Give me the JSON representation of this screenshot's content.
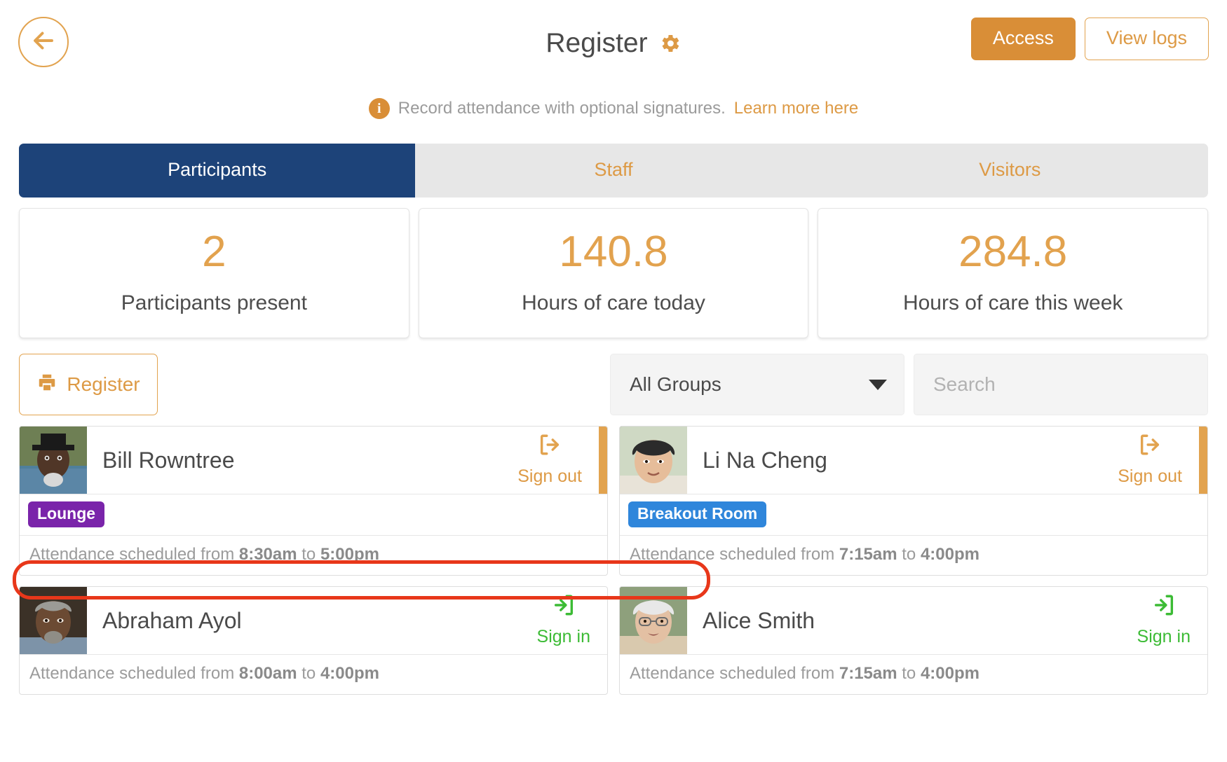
{
  "header": {
    "back_icon": "arrow-left-icon",
    "title": "Register",
    "title_icon": "gear-icon",
    "access_label": "Access",
    "view_logs_label": "View logs"
  },
  "info": {
    "icon": "info-icon",
    "badge_text": "i",
    "text": "Record attendance with optional signatures.",
    "link_text": "Learn more here"
  },
  "tabs": [
    {
      "label": "Participants",
      "active": true
    },
    {
      "label": "Staff",
      "active": false
    },
    {
      "label": "Visitors",
      "active": false
    }
  ],
  "stats": [
    {
      "value": "2",
      "label": "Participants present"
    },
    {
      "value": "140.8",
      "label": "Hours of care today"
    },
    {
      "value": "284.8",
      "label": "Hours of care this week"
    }
  ],
  "toolbar": {
    "register_label": "Register",
    "register_icon": "printer-icon",
    "group_filter_value": "All Groups",
    "group_filter_icon": "chevron-down-icon",
    "search_placeholder": "Search"
  },
  "people": [
    {
      "name": "Bill Rowntree",
      "action_label": "Sign out",
      "action_type": "sign-out",
      "action_icon": "sign-out-icon",
      "badge": {
        "text": "Lounge",
        "color": "#7a24aa"
      },
      "schedule_prefix": "Attendance scheduled from",
      "start_time": "8:30am",
      "schedule_mid": "to",
      "end_time": "5:00pm"
    },
    {
      "name": "Li Na Cheng",
      "action_label": "Sign out",
      "action_type": "sign-out",
      "action_icon": "sign-out-icon",
      "badge": {
        "text": "Breakout Room",
        "color": "#2f86db"
      },
      "schedule_prefix": "Attendance scheduled from",
      "start_time": "7:15am",
      "schedule_mid": "to",
      "end_time": "4:00pm"
    },
    {
      "name": "Abraham Ayol",
      "action_label": "Sign in",
      "action_type": "sign-in",
      "action_icon": "sign-in-icon",
      "badge": null,
      "schedule_prefix": "Attendance scheduled from",
      "start_time": "8:00am",
      "schedule_mid": "to",
      "end_time": "4:00pm"
    },
    {
      "name": "Alice Smith",
      "action_label": "Sign in",
      "action_type": "sign-in",
      "action_icon": "sign-in-icon",
      "badge": null,
      "schedule_prefix": "Attendance scheduled from",
      "start_time": "7:15am",
      "schedule_mid": "to",
      "end_time": "4:00pm"
    }
  ],
  "colors": {
    "accent_orange": "#d98e37",
    "tab_active_blue": "#1d4379",
    "sign_in_green": "#3cbb35",
    "highlight_red": "#e8371a"
  }
}
